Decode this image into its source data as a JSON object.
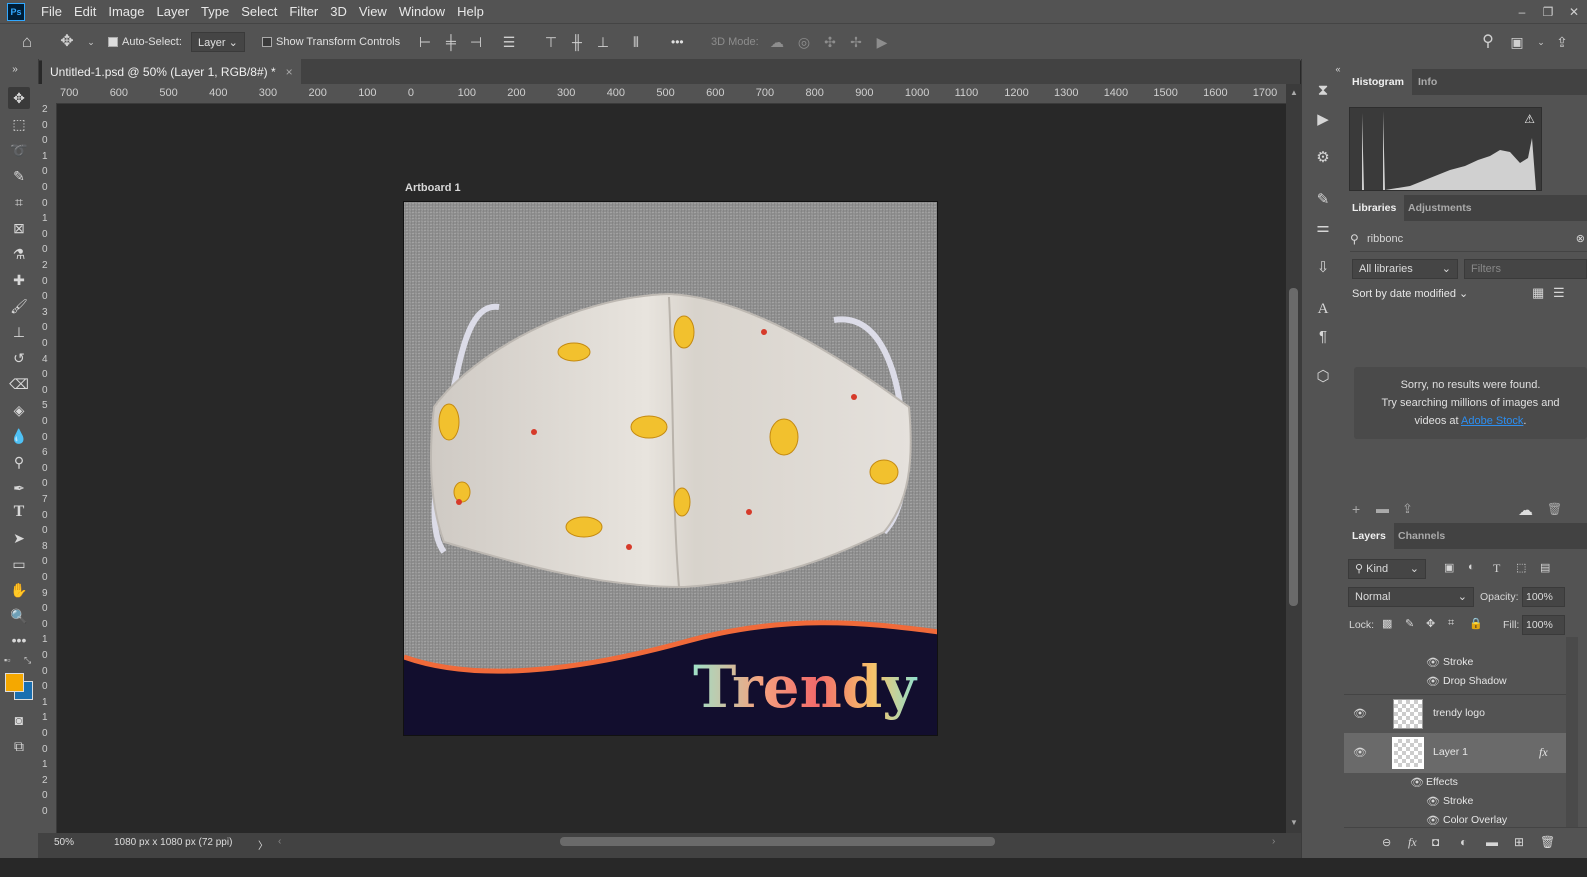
{
  "menu": [
    "File",
    "Edit",
    "Image",
    "Layer",
    "Type",
    "Select",
    "Filter",
    "3D",
    "View",
    "Window",
    "Help"
  ],
  "window_controls": {
    "minimize": "–",
    "restore": "❐",
    "close": "✕"
  },
  "options_bar": {
    "auto_select_label": "Auto-Select:",
    "auto_select_checked": true,
    "auto_select_target": "Layer",
    "show_transform_label": "Show Transform Controls",
    "mode_3d_label": "3D Mode:",
    "more": "•••"
  },
  "document_tab": {
    "title": "Untitled-1.psd @ 50% (Layer 1, RGB/8#) *",
    "close": "×"
  },
  "ruler_top": [
    "700",
    "600",
    "500",
    "400",
    "300",
    "200",
    "100",
    "0",
    "100",
    "200",
    "300",
    "400",
    "500",
    "600",
    "700",
    "800",
    "900",
    "1000",
    "1100",
    "1200",
    "1300",
    "1400",
    "1500",
    "1600",
    "1700"
  ],
  "ruler_left": [
    "2",
    "0",
    "0",
    "1",
    "0",
    "0",
    "0",
    "1",
    "0",
    "0",
    "2",
    "0",
    "0",
    "3",
    "0",
    "0",
    "4",
    "0",
    "0",
    "5",
    "0",
    "0",
    "6",
    "0",
    "0",
    "7",
    "0",
    "0",
    "8",
    "0",
    "0",
    "9",
    "0",
    "0",
    "1",
    "0",
    "0",
    "0",
    "1",
    "1",
    "0",
    "0",
    "1",
    "2",
    "0",
    "0"
  ],
  "artboard": {
    "label": "Artboard 1",
    "logo_text": "Trendy"
  },
  "status": {
    "zoom": "50%",
    "doc_info": "1080 px x 1080 px (72 ppi)",
    "arrow": "〉"
  },
  "colors": {
    "foreground": "#f5a800",
    "background": "#1a6fb0",
    "navy": "#120e2e",
    "orange": "#f06a3a"
  },
  "histogram_panel": {
    "tabs": [
      "Histogram",
      "Info"
    ],
    "warning": "⚠"
  },
  "libraries_panel": {
    "tabs": [
      "Libraries",
      "Adjustments"
    ],
    "search_value": "ribbonc",
    "library_select": "All libraries",
    "filters_placeholder": "Filters",
    "sort_label": "Sort by date modified",
    "message_line1": "Sorry, no results were found.",
    "message_line2": "Try searching millions of images and",
    "message_line3_prefix": "videos at ",
    "stock_link": "Adobe Stock",
    "message_suffix": "."
  },
  "layers_panel": {
    "tabs": [
      "Layers",
      "Channels"
    ],
    "kind_label": "Kind",
    "blend_mode": "Normal",
    "opacity_label": "Opacity:",
    "opacity_value": "100%",
    "lock_label": "Lock:",
    "fill_label": "Fill:",
    "fill_value": "100%",
    "top_effects": [
      "Stroke",
      "Drop Shadow"
    ],
    "layers": [
      {
        "name": "trendy logo"
      },
      {
        "name": "Layer 1",
        "fx": "fx"
      }
    ],
    "effects_label": "Effects",
    "layer1_effects": [
      "Stroke",
      "Color Overlay"
    ]
  }
}
